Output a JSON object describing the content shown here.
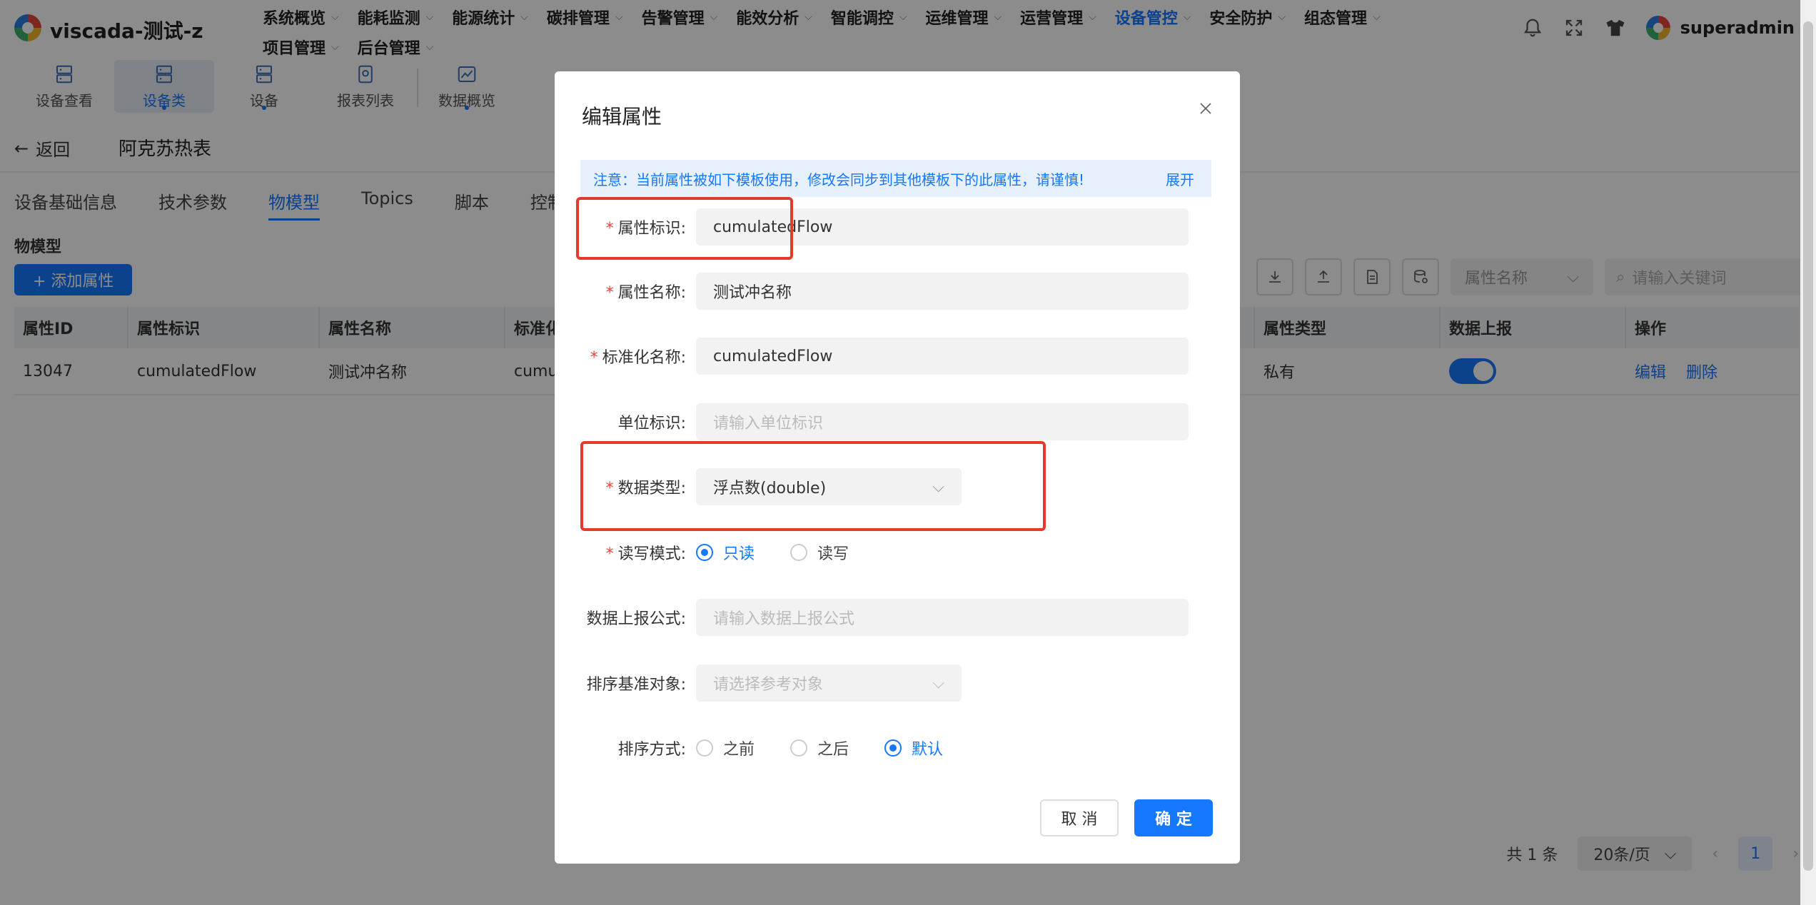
{
  "app": {
    "title": "viscada-测试-z"
  },
  "nav": {
    "row1": [
      "系统概览",
      "能耗监测",
      "能源统计",
      "碳排管理",
      "告警管理",
      "能效分析",
      "智能调控",
      "运维管理",
      "运营管理",
      "设备管控",
      "安全防护",
      "组态管理"
    ],
    "row2": [
      "项目管理",
      "后台管理"
    ],
    "active": "设备管控"
  },
  "user": {
    "name": "superadmin"
  },
  "subnav": {
    "tabs": [
      "设备查看",
      "设备类",
      "设备",
      "报表列表",
      "数据概览"
    ],
    "active": "设备类"
  },
  "page": {
    "back_label": "返回",
    "device_name": "阿克苏热表",
    "tabs": [
      "设备基础信息",
      "技术参数",
      "物模型",
      "Topics",
      "脚本",
      "控制"
    ],
    "active_tab": "物模型",
    "section_title": "物模型",
    "add_button": "+ 添加属性",
    "filter_select": "属性名称",
    "search_placeholder": "请输入关键词"
  },
  "table": {
    "headers": [
      "属性ID",
      "属性标识",
      "属性名称",
      "标准化",
      "属性类型",
      "数据上报",
      "操作"
    ],
    "rows": [
      {
        "id": "13047",
        "identifier": "cumulatedFlow",
        "name": "测试冲名称",
        "std": "cumu",
        "type": "私有",
        "report": true,
        "actions": [
          "编辑",
          "删除"
        ]
      }
    ]
  },
  "pager": {
    "total": "共 1 条",
    "page_size": "20条/页",
    "current": "1"
  },
  "modal": {
    "title": "编辑属性",
    "notice": "注意：当前属性被如下模板使用，修改会同步到其他模板下的此属性，请谨慎!",
    "notice_action": "展开",
    "fields": {
      "identifier": {
        "label": "属性标识:",
        "value": "cumulatedFlow"
      },
      "name": {
        "label": "属性名称:",
        "value": "测试冲名称"
      },
      "std_name": {
        "label": "标准化名称:",
        "value": "cumulatedFlow"
      },
      "unit": {
        "label": "单位标识:",
        "placeholder": "请输入单位标识"
      },
      "data_type": {
        "label": "数据类型:",
        "value": "浮点数(double)"
      },
      "rw_mode": {
        "label": "读写模式:",
        "options": [
          "只读",
          "读写"
        ],
        "selected": "只读"
      },
      "formula": {
        "label": "数据上报公式:",
        "placeholder": "请输入数据上报公式"
      },
      "sort_ref": {
        "label": "排序基准对象:",
        "placeholder": "请选择参考对象"
      },
      "sort_mode": {
        "label": "排序方式:",
        "options": [
          "之前",
          "之后",
          "默认"
        ],
        "selected": "默认"
      }
    },
    "cancel_label": "取 消",
    "ok_label": "确 定"
  },
  "colors": {
    "primary": "#1677ff",
    "highlight": "#e33a2e",
    "required": "#e6453a"
  }
}
